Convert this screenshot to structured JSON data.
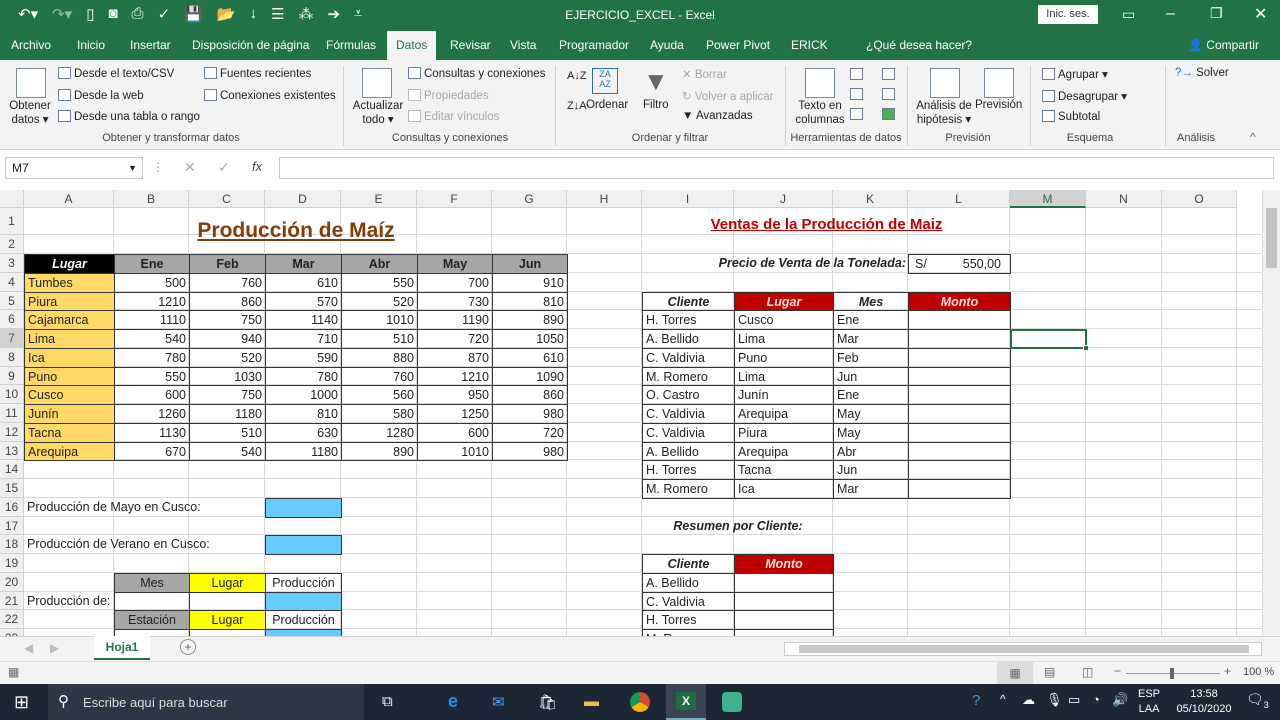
{
  "app": {
    "title": "EJERCICIO_EXCEL - Excel",
    "sign_in": "Inic. ses.",
    "share": "Compartir",
    "accent": "#217346"
  },
  "qat": [
    "undo-icon",
    "redo-icon",
    "new-icon",
    "camera-icon",
    "print-preview-icon",
    "spelling-icon",
    "save-icon",
    "open-icon",
    "sort-icon",
    "form-icon",
    "org-icon",
    "go-icon",
    "customize-icon"
  ],
  "tabs": [
    "Archivo",
    "Inicio",
    "Insertar",
    "Disposición de página",
    "Fórmulas",
    "Datos",
    "Revisar",
    "Vista",
    "Programador",
    "Ayuda",
    "Power Pivot",
    "ERICK",
    "¿Qué desea hacer?"
  ],
  "selected_tab": "Datos",
  "ribbon": {
    "obtener": {
      "big": "Obtener",
      "big2": "datos",
      "items": [
        "Desde el texto/CSV",
        "Desde la web",
        "Desde una tabla o rango",
        "Fuentes recientes",
        "Conexiones existentes"
      ],
      "group": "Obtener y transformar datos"
    },
    "consultas": {
      "big": "Actualizar",
      "big2": "todo",
      "items": [
        "Consultas y conexiones",
        "Propiedades",
        "Editar vínculos"
      ],
      "group": "Consultas y conexiones"
    },
    "ordenar": {
      "ordenar": "Ordenar",
      "filtro": "Filtro",
      "items": [
        "Borrar",
        "Volver a aplicar",
        "Avanzadas"
      ],
      "group": "Ordenar y filtrar"
    },
    "herramientas": {
      "big": "Texto en",
      "big2": "columnas",
      "group": "Herramientas de datos"
    },
    "prevision": {
      "a1": "Análisis de",
      "a2": "hipótesis",
      "p": "Previsión",
      "group": "Previsión"
    },
    "esquema": {
      "items": [
        "Agrupar",
        "Desagrupar",
        "Subtotal"
      ],
      "group": "Esquema"
    },
    "analisis": {
      "solver": "Solver",
      "group": "Análisis"
    }
  },
  "formula_bar": {
    "name_box": "M7",
    "formula": ""
  },
  "columns": [
    "A",
    "B",
    "C",
    "D",
    "E",
    "F",
    "G",
    "H",
    "I",
    "J",
    "K",
    "L",
    "M",
    "N",
    "O"
  ],
  "selected_cell": "M7",
  "sheet": {
    "title": "Producción de Maíz",
    "production": {
      "headers": [
        "Lugar",
        "Ene",
        "Feb",
        "Mar",
        "Abr",
        "May",
        "Jun"
      ],
      "rows": [
        [
          "Tumbes",
          500,
          760,
          610,
          550,
          700,
          910
        ],
        [
          "Piura",
          1210,
          860,
          570,
          520,
          730,
          810
        ],
        [
          "Cajamarca",
          1110,
          750,
          1140,
          1010,
          1190,
          890
        ],
        [
          "Lima",
          540,
          940,
          710,
          510,
          720,
          1050
        ],
        [
          "Ica",
          780,
          520,
          590,
          880,
          870,
          610
        ],
        [
          "Puno",
          550,
          1030,
          780,
          760,
          1210,
          1090
        ],
        [
          "Cusco",
          600,
          750,
          1000,
          560,
          950,
          860
        ],
        [
          "Junín",
          1260,
          1180,
          810,
          580,
          1250,
          980
        ],
        [
          "Tacna",
          1130,
          510,
          630,
          1280,
          600,
          720
        ],
        [
          "Arequipa",
          670,
          540,
          1180,
          890,
          1010,
          980
        ]
      ]
    },
    "q16": "Producción de Mayo en Cusco:",
    "q18": "Producción de Verano en Cusco:",
    "q21": "Producción de:",
    "mes": "Mes",
    "lugar": "Lugar",
    "produccion": "Producción",
    "estacion": "Estación",
    "sales_title": "Ventas de la Producción de Maiz",
    "price_label": "Precio de Venta de la Tonelada:",
    "price_currency": "S/",
    "price_value": "550,00",
    "sales": {
      "headers": [
        "Cliente",
        "Lugar",
        "Mes",
        "Monto"
      ],
      "rows": [
        [
          "H. Torres",
          "Cusco",
          "Ene"
        ],
        [
          "A. Bellido",
          "Lima",
          "Mar"
        ],
        [
          "C. Valdivia",
          "Puno",
          "Feb"
        ],
        [
          "M. Romero",
          "Lima",
          "Jun"
        ],
        [
          "O. Castro",
          "Junín",
          "Ene"
        ],
        [
          "C. Valdivia",
          "Arequipa",
          "May"
        ],
        [
          "C. Valdivia",
          "Piura",
          "May"
        ],
        [
          "A. Bellido",
          "Arequipa",
          "Abr"
        ],
        [
          "H. Torres",
          "Tacna",
          "Jun"
        ],
        [
          "M. Romero",
          "Ica",
          "Mar"
        ]
      ]
    },
    "summary_title": "Resumen por Cliente:",
    "summary": {
      "headers": [
        "Cliente",
        "Monto"
      ],
      "rows": [
        "A. Bellido",
        "C. Valdivia",
        "H. Torres",
        "M. Romero"
      ]
    },
    "colors": {
      "title": "#843c0c",
      "red": "#c00000",
      "orange": "#ffd966",
      "gray": "#a6a6a6",
      "blue": "#66ccff",
      "yellow": "#ffff00"
    }
  },
  "sheet_tab": "Hoja1",
  "status": {
    "zoom": "100 %",
    "zoom_level": 100
  },
  "taskbar": {
    "search": "Escribe aquí para buscar",
    "lang1": "ESP",
    "lang2": "LAA",
    "time": "13:58",
    "date": "05/10/2020",
    "notifications": "3"
  }
}
